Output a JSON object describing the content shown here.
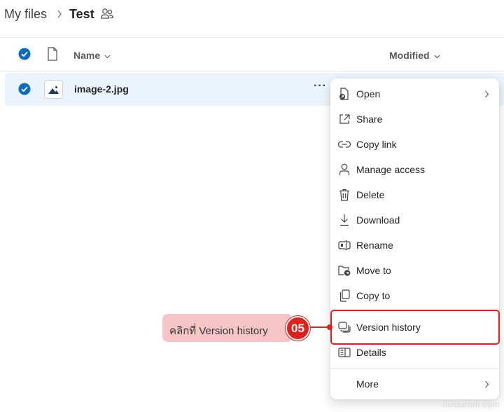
{
  "breadcrumb": {
    "root": "My files",
    "current": "Test"
  },
  "header": {
    "name_label": "Name",
    "modified_label": "Modified"
  },
  "file": {
    "name": "image-2.jpg",
    "more_label": "···"
  },
  "menu": {
    "items": [
      {
        "label": "Open",
        "icon": "open-icon",
        "submenu": true
      },
      {
        "label": "Share",
        "icon": "share-icon"
      },
      {
        "label": "Copy link",
        "icon": "link-icon"
      },
      {
        "label": "Manage access",
        "icon": "person-icon"
      },
      {
        "label": "Delete",
        "icon": "trash-icon"
      },
      {
        "label": "Download",
        "icon": "download-icon"
      },
      {
        "label": "Rename",
        "icon": "rename-icon"
      },
      {
        "label": "Move to",
        "icon": "move-icon"
      },
      {
        "label": "Copy to",
        "icon": "copy-icon"
      },
      {
        "label": "Version history",
        "icon": "version-history-icon"
      },
      {
        "label": "Details",
        "icon": "details-icon"
      },
      {
        "label": "More",
        "icon": "",
        "submenu": true
      }
    ]
  },
  "callout": {
    "text": "คลิกที่ Version history",
    "step": "05"
  },
  "watermark": "hostatom.com",
  "colors": {
    "accent": "#0f6cbd",
    "selected_row": "#ebf3fc",
    "highlight": "#e0201c",
    "callout_bg": "#f7c5c5"
  }
}
